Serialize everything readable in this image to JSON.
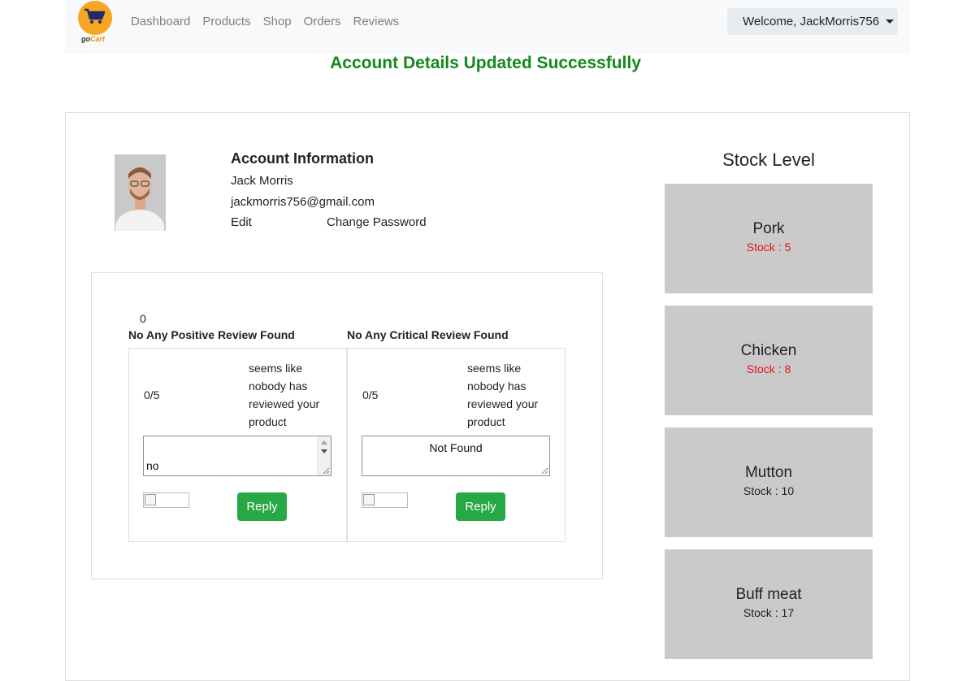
{
  "navbar": {
    "brand": {
      "go": "go",
      "cart": "Cart"
    },
    "links": [
      "Dashboard",
      "Products",
      "Shop",
      "Orders",
      "Reviews"
    ],
    "welcome": "Welcome, JackMorris756"
  },
  "alert": "Account Details Updated Successfully",
  "account": {
    "title": "Account Information",
    "name": "Jack Morris",
    "email": "jackmorris756@gmail.com",
    "edit_label": "Edit",
    "change_password_label": "Change Password"
  },
  "reviews": {
    "count": "0",
    "positive": {
      "title": "No Any Positive Review Found",
      "rating": "0/5",
      "message": "seems like nobody has reviewed your product",
      "reply_value": "no",
      "reply_label": "Reply"
    },
    "critical": {
      "title": "No Any Critical Review Found",
      "rating": "0/5",
      "message": "seems like nobody has reviewed your product",
      "reply_value": "Not Found",
      "reply_label": "Reply"
    }
  },
  "stock": {
    "title": "Stock Level",
    "items": [
      {
        "name": "Pork",
        "stock": "Stock : 5",
        "color": "#e8141a"
      },
      {
        "name": "Chicken",
        "stock": "Stock : 8",
        "color": "#e8141a"
      },
      {
        "name": "Mutton",
        "stock": "Stock : 10",
        "color": "#222222"
      },
      {
        "name": "Buff meat",
        "stock": "Stock : 17",
        "color": "#222222"
      }
    ]
  },
  "colors": {
    "success": "#14871e",
    "reply_button": "#28a745",
    "low_stock": "#e8141a"
  }
}
